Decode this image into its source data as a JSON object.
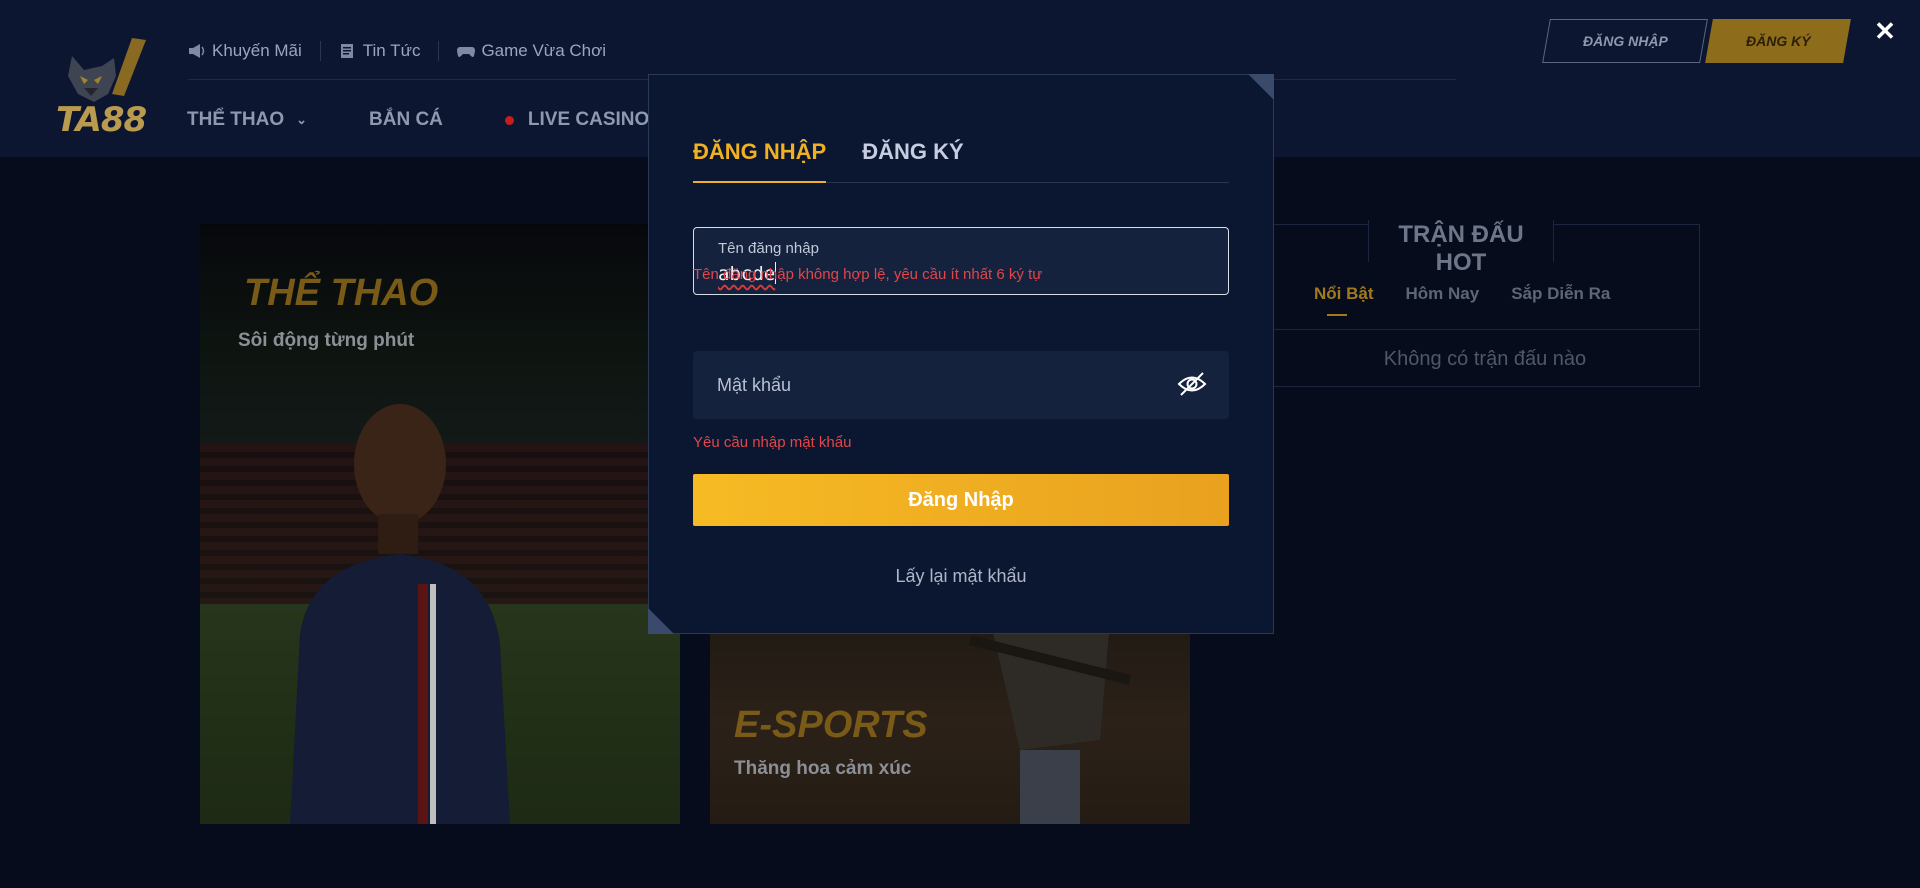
{
  "header": {
    "logo_text": "TA88",
    "top_links": [
      {
        "label": "Khuyến Mãi",
        "icon": "megaphone-icon"
      },
      {
        "label": "Tin Tức",
        "icon": "news-icon"
      },
      {
        "label": "Game Vừa Chơi",
        "icon": "gamepad-icon"
      }
    ],
    "main_nav": [
      {
        "label": "THỂ THAO",
        "icon": "chevron-down-icon"
      },
      {
        "label": "BẮN CÁ"
      },
      {
        "label": "LIVE CASINO",
        "icon": "live-dot-icon"
      }
    ],
    "login_button": "ĐĂNG NHẬP",
    "register_button": "ĐĂNG KÝ",
    "close_symbol": "✕"
  },
  "cards": {
    "sport": {
      "title": "THỂ THAO",
      "subtitle": "Sôi động từng phút"
    },
    "esport": {
      "title": "E-SPORTS",
      "subtitle": "Thăng hoa cảm xúc"
    }
  },
  "hot_matches": {
    "title": "TRẬN ĐẤU HOT",
    "tabs": [
      {
        "label": "Nổi Bật",
        "active": true
      },
      {
        "label": "Hôm Nay",
        "active": false
      },
      {
        "label": "Sắp Diễn Ra",
        "active": false
      }
    ],
    "empty_text": "Không có trận đấu nào"
  },
  "modal": {
    "tabs": [
      {
        "label": "ĐĂNG NHẬP",
        "active": true
      },
      {
        "label": "ĐĂNG KÝ",
        "active": false
      }
    ],
    "username": {
      "label": "Tên đăng nhập",
      "value": "abcde",
      "error": "Tên đăng nhập không hợp lệ, yêu cầu ít nhất 6 ký tự"
    },
    "password": {
      "placeholder": "Mật khẩu",
      "error": "Yêu cầu nhập mật khẩu",
      "toggle_icon": "eye-slash-icon"
    },
    "submit_label": "Đăng Nhập",
    "forgot_label": "Lấy lại mật khẩu"
  },
  "colors": {
    "accent": "#f0b023",
    "error": "#e0464a",
    "modal_bg": "#0b1731",
    "page_bg": "#060c1c"
  }
}
